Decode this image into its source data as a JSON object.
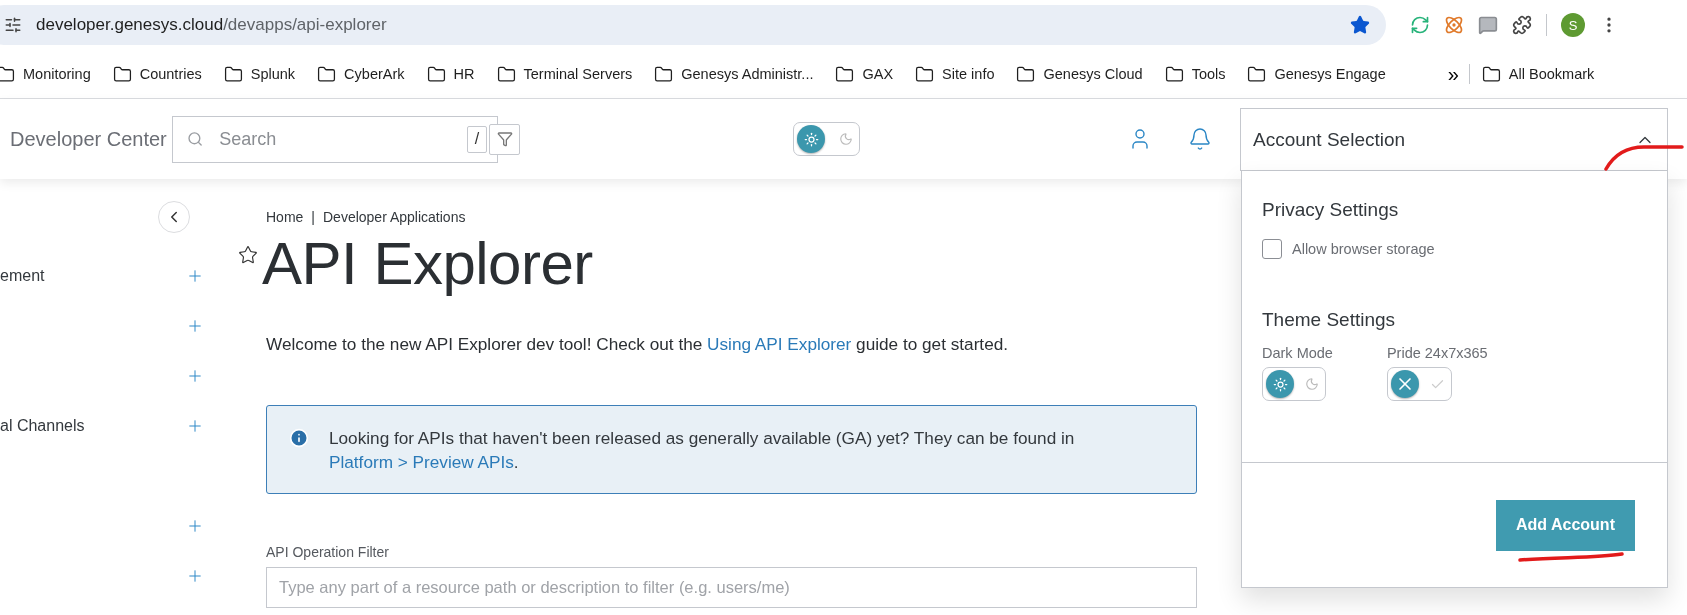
{
  "browser": {
    "url_host": "developer.genesys.cloud",
    "url_path": "/devapps/api-explorer",
    "bookmarked": true,
    "profile_initial": "S",
    "bookmarks": [
      {
        "label": "Monitoring"
      },
      {
        "label": "Countries"
      },
      {
        "label": "Splunk"
      },
      {
        "label": "CyberArk"
      },
      {
        "label": "HR"
      },
      {
        "label": "Terminal Servers"
      },
      {
        "label": "Genesys Administr..."
      },
      {
        "label": "GAX"
      },
      {
        "label": "Site info"
      },
      {
        "label": "Genesys Cloud"
      },
      {
        "label": "Tools"
      },
      {
        "label": "Genesys Engage"
      }
    ],
    "overflow": "»",
    "all_bookmarks": "All Bookmark"
  },
  "header": {
    "title": "Developer Center",
    "search": {
      "placeholder": "Search",
      "shortcut": "/"
    },
    "dark_mode": false,
    "account": {
      "label": "Account Selection",
      "expanded": true
    }
  },
  "sidebar": {
    "items": [
      {
        "label": "ement",
        "expanded": false
      },
      {
        "expanded": false
      },
      {
        "expanded": false
      },
      {
        "label": "al Channels",
        "expanded": false
      },
      {
        "expanded": false
      },
      {
        "expanded": false
      }
    ]
  },
  "main": {
    "breadcrumb": [
      "Home",
      "Developer Applications"
    ],
    "breadcrumb_separator": "|",
    "favorite": false,
    "title": "API Explorer",
    "intro": {
      "before": "Welcome to the new API Explorer dev tool! Check out the",
      "link": "Using API Explorer",
      "after": "guide to get started."
    },
    "notice": {
      "text": "Looking for APIs that haven't been released as generally available (GA) yet? They can be found in",
      "link": "Platform > Preview APIs",
      "after": "."
    },
    "filter": {
      "label": "API Operation Filter",
      "placeholder": "Type any part of a resource path or description to filter (e.g. users/me)"
    }
  },
  "account_panel": {
    "privacy_title": "Privacy Settings",
    "allow_storage": {
      "label": "Allow browser storage",
      "checked": false
    },
    "theme_title": "Theme Settings",
    "toggles": [
      {
        "label": "Dark Mode",
        "kind": "theme",
        "on": false
      },
      {
        "label": "Pride 24x7x365",
        "kind": "pride",
        "on": false
      }
    ],
    "button": "Add Account"
  }
}
